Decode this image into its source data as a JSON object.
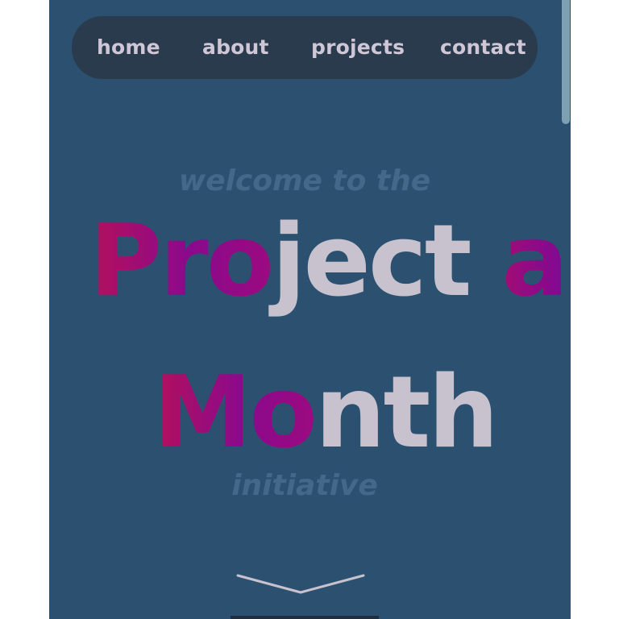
{
  "nav": {
    "items": [
      {
        "label": "home"
      },
      {
        "label": "about"
      },
      {
        "label": "projects"
      },
      {
        "label": "contact"
      }
    ]
  },
  "hero": {
    "kicker": "welcome to the",
    "title_line_1_parts": [
      {
        "text": "Pro",
        "style": "gradient"
      },
      {
        "text": "ject",
        "style": "plain"
      },
      {
        "text": " a",
        "style": "gradient"
      }
    ],
    "title_line_2_parts": [
      {
        "text": "Mo",
        "style": "gradient"
      },
      {
        "text": "nth",
        "style": "plain"
      }
    ],
    "subtitle": "initiative"
  },
  "colors": {
    "page_bg": "#2c5170",
    "nav_bg": "#2a3b4e",
    "nav_text": "#cfc6d6",
    "faded_text": "#43688a",
    "title_plain": "#c8c2cf",
    "accent_magenta": "#b3105c",
    "accent_purple": "#8a0a8c",
    "scrollbar_thumb": "#7ea0b3"
  },
  "icons": {
    "scroll_indicator": "chevron-down-icon"
  }
}
